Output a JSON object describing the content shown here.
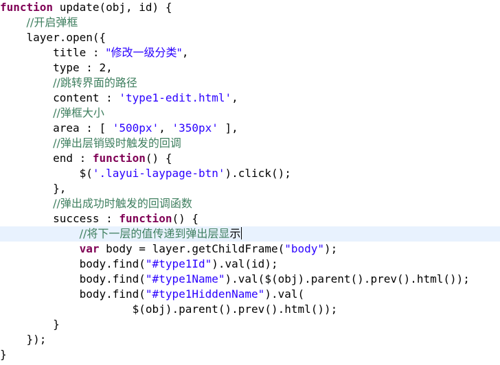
{
  "editor": {
    "lines": [
      {
        "indent": "",
        "tokens": [
          {
            "t": "function",
            "c": "kw"
          },
          {
            "t": " update(obj, id) {"
          }
        ]
      },
      {
        "indent": "    ",
        "tokens": [
          {
            "t": "//开启弹框",
            "c": "cm"
          }
        ]
      },
      {
        "indent": "    ",
        "tokens": [
          {
            "t": "layer.open({"
          }
        ]
      },
      {
        "indent": "        ",
        "tokens": [
          {
            "t": "title : "
          },
          {
            "t": "\"修改一级分类\"",
            "c": "str"
          },
          {
            "t": ","
          }
        ]
      },
      {
        "indent": "        ",
        "tokens": [
          {
            "t": "type : 2,"
          }
        ]
      },
      {
        "indent": "        ",
        "tokens": [
          {
            "t": "//跳转界面的路径",
            "c": "cm"
          }
        ]
      },
      {
        "indent": "        ",
        "tokens": [
          {
            "t": "content : "
          },
          {
            "t": "'type1-edit.html'",
            "c": "str"
          },
          {
            "t": ","
          }
        ]
      },
      {
        "indent": "        ",
        "tokens": [
          {
            "t": "//弹框大小",
            "c": "cm"
          }
        ]
      },
      {
        "indent": "        ",
        "tokens": [
          {
            "t": "area : [ "
          },
          {
            "t": "'500px'",
            "c": "str"
          },
          {
            "t": ", "
          },
          {
            "t": "'350px'",
            "c": "str"
          },
          {
            "t": " ],"
          }
        ]
      },
      {
        "indent": "        ",
        "tokens": [
          {
            "t": "//弹出层销毁时触发的回调",
            "c": "cm"
          }
        ]
      },
      {
        "indent": "        ",
        "tokens": [
          {
            "t": "end : "
          },
          {
            "t": "function",
            "c": "kw"
          },
          {
            "t": "() {"
          }
        ]
      },
      {
        "indent": "            ",
        "tokens": [
          {
            "t": "$("
          },
          {
            "t": "'.layui-laypage-btn'",
            "c": "str"
          },
          {
            "t": ").click();"
          }
        ]
      },
      {
        "indent": "        ",
        "tokens": [
          {
            "t": "},"
          }
        ]
      },
      {
        "indent": "        ",
        "tokens": [
          {
            "t": "//弹出成功时触发的回调函数",
            "c": "cm"
          }
        ]
      },
      {
        "indent": "        ",
        "tokens": [
          {
            "t": "success : "
          },
          {
            "t": "function",
            "c": "kw"
          },
          {
            "t": "() {"
          }
        ]
      },
      {
        "indent": "            ",
        "tokens": [
          {
            "t": "//将下一层的值传递到弹出层显",
            "c": "cm"
          },
          {
            "t": "示"
          }
        ],
        "current": true
      },
      {
        "indent": "            ",
        "tokens": [
          {
            "t": "var",
            "c": "kw"
          },
          {
            "t": " body = layer.getChildFrame("
          },
          {
            "t": "\"body\"",
            "c": "str"
          },
          {
            "t": ");"
          }
        ]
      },
      {
        "indent": "            ",
        "tokens": [
          {
            "t": "body.find("
          },
          {
            "t": "\"#type1Id\"",
            "c": "str"
          },
          {
            "t": ").val(id);"
          }
        ]
      },
      {
        "indent": "            ",
        "tokens": [
          {
            "t": "body.find("
          },
          {
            "t": "\"#type1Name\"",
            "c": "str"
          },
          {
            "t": ").val($(obj).parent().prev().html());"
          }
        ]
      },
      {
        "indent": "            ",
        "tokens": [
          {
            "t": "body.find("
          },
          {
            "t": "\"#type1HiddenName\"",
            "c": "str"
          },
          {
            "t": ").val("
          }
        ]
      },
      {
        "indent": "                    ",
        "tokens": [
          {
            "t": "$(obj).parent().prev().html());"
          }
        ]
      },
      {
        "indent": "        ",
        "tokens": [
          {
            "t": "}"
          }
        ]
      },
      {
        "indent": "    ",
        "tokens": [
          {
            "t": "});"
          }
        ]
      },
      {
        "indent": "",
        "tokens": [
          {
            "t": "}"
          }
        ]
      }
    ]
  },
  "colors": {
    "keyword": "#7f0055",
    "string": "#2a00ff",
    "comment": "#3f7f5f",
    "current_line_bg": "#e8f2fe"
  }
}
